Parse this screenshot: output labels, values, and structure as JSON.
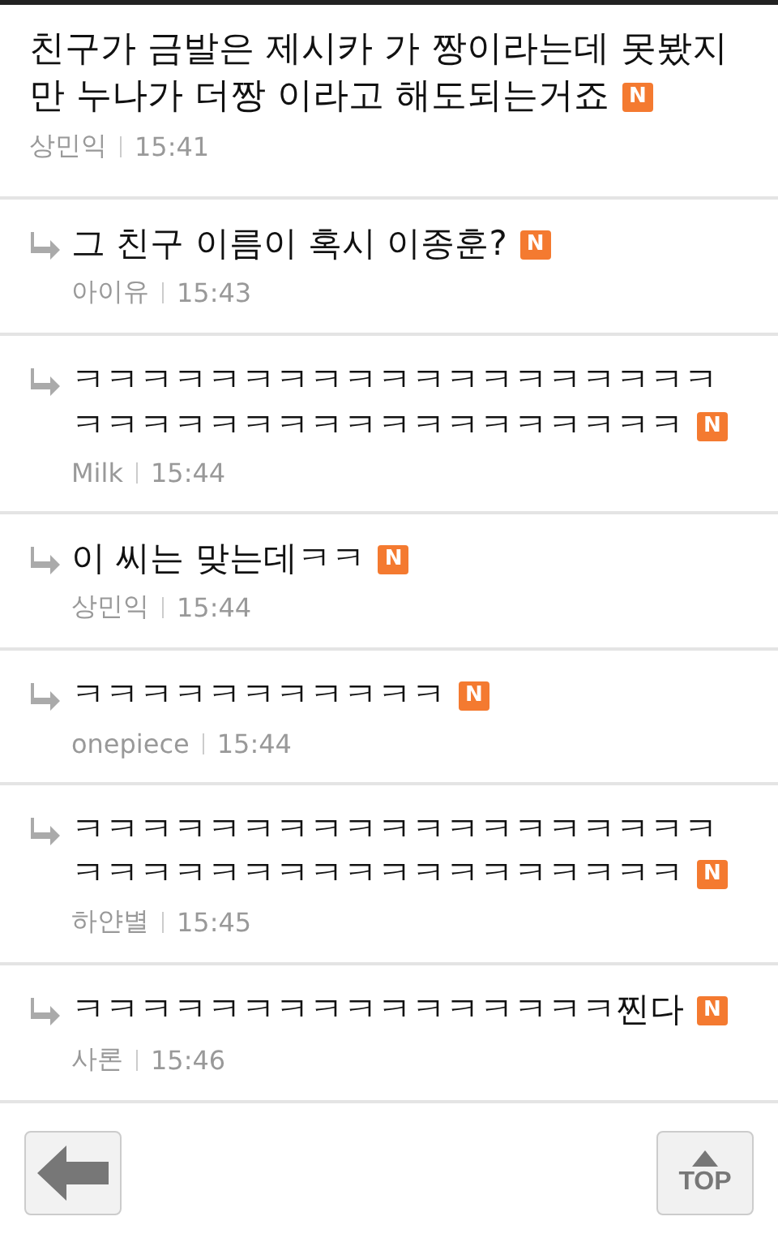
{
  "comments": [
    {
      "kind": "post",
      "text": "친구가 금발은 제시카 가 짱이라는데 못봤지만 누나가 더짱 이라고 해도되는거죠",
      "badge": "N",
      "author": "상민익",
      "time": "15:41"
    },
    {
      "kind": "reply",
      "text": "그 친구 이름이 혹시 이종훈?",
      "badge": "N",
      "author": "아이유",
      "time": "15:43"
    },
    {
      "kind": "reply",
      "text": "ㅋㅋㅋㅋㅋㅋㅋㅋㅋㅋㅋㅋㅋㅋㅋㅋㅋㅋㅋㅋㅋㅋㅋㅋㅋㅋㅋㅋㅋㅋㅋㅋㅋㅋㅋㅋㅋ",
      "badge": "N",
      "author": "Milk",
      "time": "15:44"
    },
    {
      "kind": "reply",
      "text": "이 씨는 맞는데ㅋㅋ",
      "badge": "N",
      "author": "상민익",
      "time": "15:44"
    },
    {
      "kind": "reply",
      "text": "ㅋㅋㅋㅋㅋㅋㅋㅋㅋㅋㅋ",
      "badge": "N",
      "author": "onepiece",
      "time": "15:44"
    },
    {
      "kind": "reply",
      "text": "ㅋㅋㅋㅋㅋㅋㅋㅋㅋㅋㅋㅋㅋㅋㅋㅋㅋㅋㅋㅋㅋㅋㅋㅋㅋㅋㅋㅋㅋㅋㅋㅋㅋㅋㅋㅋㅋ",
      "badge": "N",
      "author": "하얀별",
      "time": "15:45"
    },
    {
      "kind": "reply",
      "text": "ㅋㅋㅋㅋㅋㅋㅋㅋㅋㅋㅋㅋㅋㅋㅋㅋ찐다",
      "badge": "N",
      "author": "사론",
      "time": "15:46"
    }
  ],
  "top_button": {
    "label": "TOP"
  }
}
